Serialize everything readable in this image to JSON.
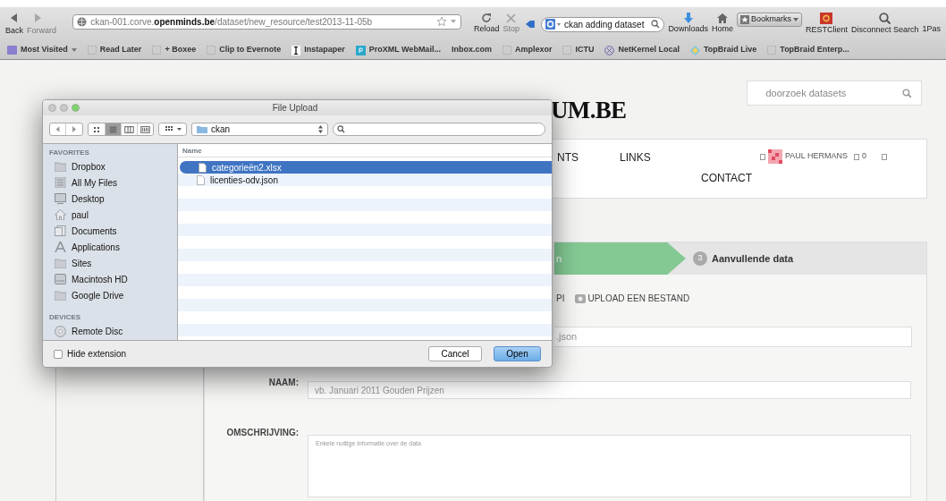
{
  "browser": {
    "nav_buttons": [
      {
        "label": "Back",
        "disabled": false
      },
      {
        "label": "Forward",
        "disabled": true
      }
    ],
    "url": "ckan-001.corve.**openminds.be**/dataset/new_resource/test2013-11-05b",
    "reload": {
      "label": "Reload",
      "disabled": false
    },
    "stop": {
      "label": "Stop",
      "disabled": true
    },
    "search": {
      "value": "ckan adding dataset"
    },
    "toolbar_buttons": [
      {
        "label": "Downloads",
        "kind": "download"
      },
      {
        "label": "Home",
        "kind": "home"
      },
      {
        "label": "Bookmarks",
        "kind": "bookmarks"
      },
      {
        "label": "RESTClient",
        "kind": "rest"
      },
      {
        "label": "Disconnect Search",
        "kind": "disconnect"
      },
      {
        "label": "1Pas",
        "kind": "plain"
      }
    ],
    "bookmarks": [
      {
        "label": "Most Visited",
        "kind": "menu"
      },
      {
        "label": "Read Later",
        "kind": "page"
      },
      {
        "label": "+ Boxee",
        "kind": "page"
      },
      {
        "label": "Clip to Evernote",
        "kind": "page"
      },
      {
        "label": "Instapaper",
        "kind": "instapaper"
      },
      {
        "label": "ProXML WebMail...",
        "kind": "proxml"
      },
      {
        "label": "Inbox.com",
        "kind": "none"
      },
      {
        "label": "Amplexor",
        "kind": "page"
      },
      {
        "label": "ICTU",
        "kind": "page"
      },
      {
        "label": "NetKernel Local",
        "kind": "netkernel"
      },
      {
        "label": "TopBraid Live",
        "kind": "topbraid"
      },
      {
        "label": "TopBraid Enterp...",
        "kind": "page"
      }
    ]
  },
  "page": {
    "logo": "UM.BE",
    "search": {
      "placeholder": "doorzoek datasets"
    },
    "nav": [
      "NTS",
      "LINKS",
      "CONTACT"
    ],
    "user": {
      "name": "PAUL HERMANS",
      "count": "0"
    },
    "steps": [
      {
        "label": "n",
        "kind": "done"
      },
      {
        "number": "3",
        "label": "Aanvullende data",
        "kind": "pending"
      }
    ],
    "upload_options": [
      {
        "label": "PI",
        "kind": "text"
      },
      {
        "label": "UPLOAD EEN BESTAND",
        "kind": "upload"
      }
    ],
    "url_field": {
      "value": ".json"
    },
    "fields": [
      {
        "label": "NAAM:",
        "placeholder": "vb. Januari 2011 Gouden Prijzen",
        "kind": "input"
      },
      {
        "label": "OMSCHRIJVING:",
        "placeholder": "Enkele nuttige informatie over de data",
        "kind": "textarea"
      }
    ]
  },
  "dialog": {
    "title": "File Upload",
    "view_modes": [
      {
        "kind": "icons",
        "selected": false
      },
      {
        "kind": "list",
        "selected": true
      },
      {
        "kind": "columns",
        "selected": false
      },
      {
        "kind": "coverflow",
        "selected": false
      }
    ],
    "location": "ckan",
    "sidebar": [
      {
        "heading": "FAVORITES",
        "items": [
          {
            "label": "Dropbox",
            "kind": "folder"
          },
          {
            "label": "All My Files",
            "kind": "files"
          },
          {
            "label": "Desktop",
            "kind": "desktop"
          },
          {
            "label": "paul",
            "kind": "home"
          },
          {
            "label": "Documents",
            "kind": "documents"
          },
          {
            "label": "Applications",
            "kind": "apps"
          },
          {
            "label": "Sites",
            "kind": "folder"
          },
          {
            "label": "Macintosh HD",
            "kind": "disk"
          },
          {
            "label": "Google Drive",
            "kind": "folder"
          }
        ]
      },
      {
        "heading": "DEVICES",
        "items": [
          {
            "label": "Remote Disc",
            "kind": "disc"
          }
        ]
      }
    ],
    "column": "Name",
    "files": [
      {
        "name": "categorieën2.xlsx",
        "selected": true
      },
      {
        "name": "licenties-odv.json",
        "selected": false
      }
    ],
    "hide_extension": {
      "label": "Hide extension",
      "checked": false
    },
    "buttons": [
      {
        "label": "Cancel",
        "default": false
      },
      {
        "label": "Open",
        "default": true
      }
    ]
  }
}
